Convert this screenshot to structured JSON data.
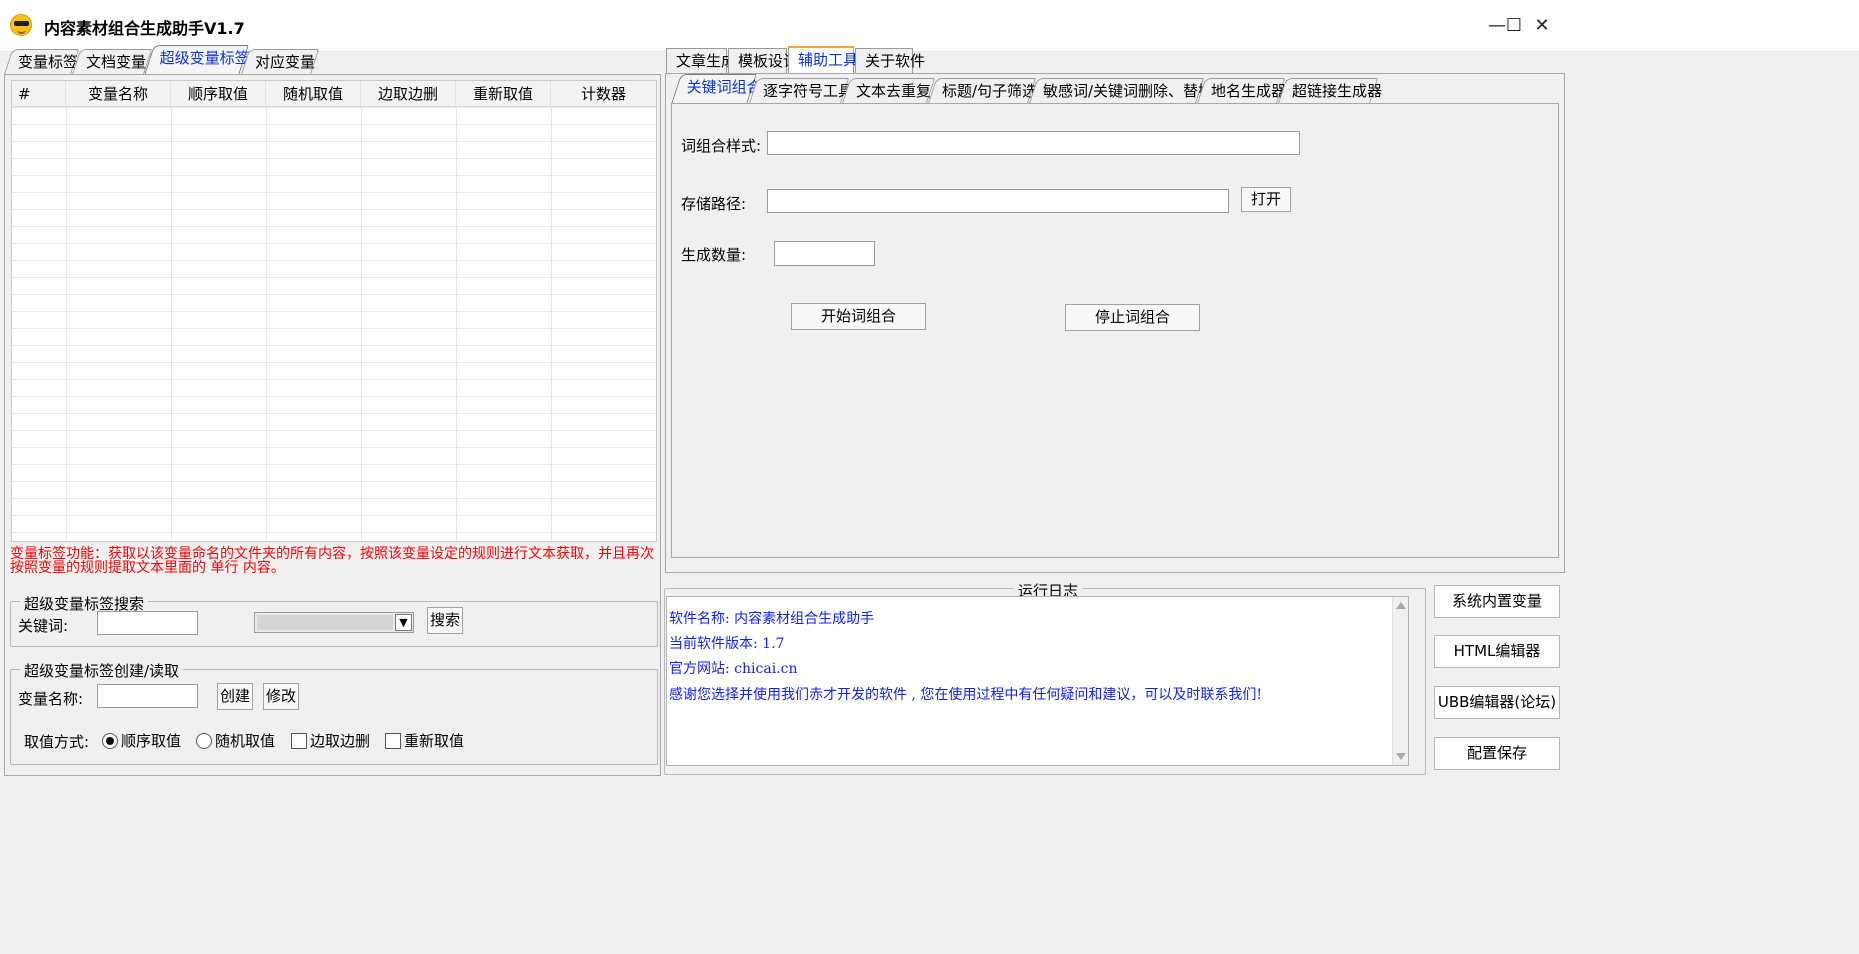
{
  "app": {
    "title": "内容素材组合生成助手V1.7"
  },
  "window_controls": {
    "minimize": "—",
    "maximize": "☐",
    "close": "✕"
  },
  "left_tabs": [
    "变量标签",
    "文档变量",
    "超级变量标签",
    "对应变量"
  ],
  "left_active_tab": "超级变量标签",
  "table": {
    "headers": [
      "#",
      "变量名称",
      "顺序取值",
      "随机取值",
      "边取边删",
      "重新取值",
      "计数器"
    ]
  },
  "description": "变量标签功能：获取以该变量命名的文件夹的所有内容，按照该变量设定的规则进行文本获取，并且再次按照变量的规则提取文本里面的 单行 内容。",
  "search_group": {
    "legend": "超级变量标签搜索",
    "keyword_label": "关键词:",
    "keyword_value": "",
    "select_value": "",
    "search_button": "搜索"
  },
  "create_group": {
    "legend": "超级变量标签创建/读取",
    "name_label": "变量名称:",
    "name_value": "",
    "create_button": "创建",
    "modify_button": "修改",
    "mode_label": "取值方式:",
    "radio_sequential": "顺序取值",
    "radio_random": "随机取值",
    "check_take_delete": "边取边删",
    "check_retake": "重新取值",
    "selected_mode": "顺序取值"
  },
  "right_tabs": [
    "文章生成",
    "模板设计",
    "辅助工具",
    "关于软件"
  ],
  "right_active_tab": "辅助工具",
  "tool_tabs": [
    "关键词组合",
    "逐字符号工具",
    "文本去重复",
    "标题/句子筛选",
    "敏感词/关键词删除、替换",
    "地名生成器",
    "超链接生成器"
  ],
  "tool_active_tab": "关键词组合",
  "keyword_combo": {
    "pattern_label": "词组合样式:",
    "pattern_value": "",
    "path_label": "存储路径:",
    "path_value": "",
    "open_button": "打开",
    "count_label": "生成数量:",
    "count_value": "",
    "start_button": "开始词组合",
    "stop_button": "停止词组合"
  },
  "log": {
    "title": "运行日志",
    "lines": [
      "软件名称: 内容素材组合生成助手",
      "当前软件版本: 1.7",
      "官方网站: chicai.cn",
      "感谢您选择并使用我们赤才开发的软件 , 您在使用过程中有任何疑问和建议，可以及时联系我们!"
    ]
  },
  "side_buttons": [
    "系统内置变量",
    "HTML编辑器",
    "UBB编辑器(论坛)",
    "配置保存"
  ]
}
